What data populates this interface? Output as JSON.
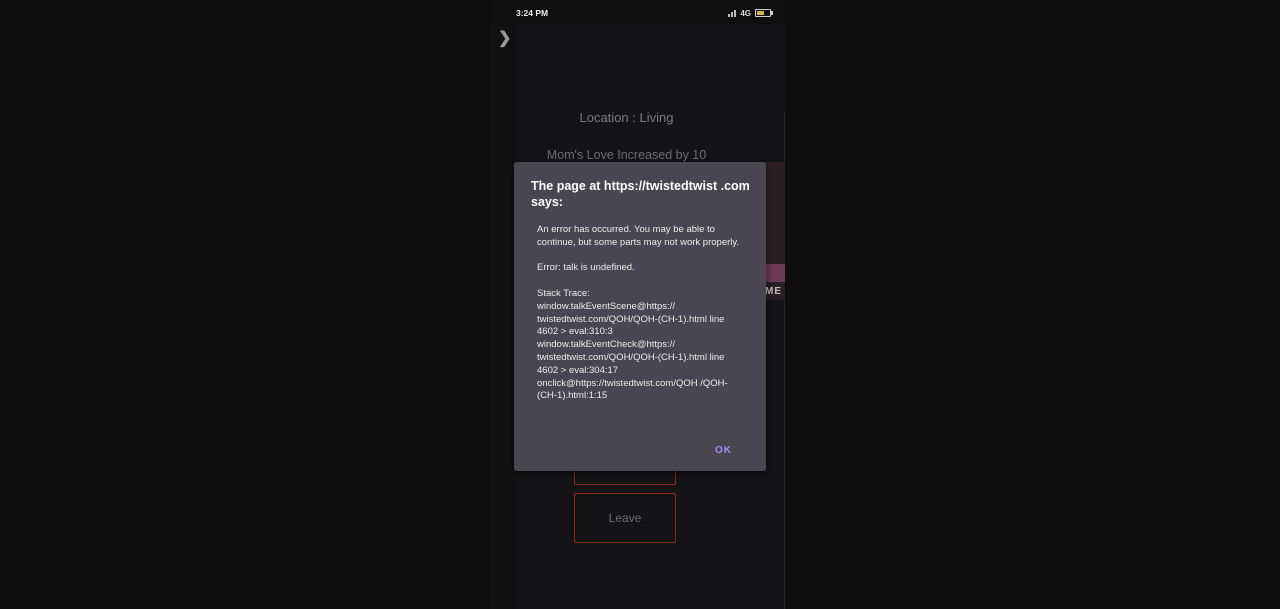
{
  "status_bar": {
    "time": "3:24 PM",
    "network": "4G"
  },
  "battery_level": 0.55,
  "game": {
    "location": "Location : Living",
    "notification": "Mom's Love Increased by 10",
    "scene_image_text": "ME",
    "leave_button": "Leave"
  },
  "dialog": {
    "title": "The page at https://twistedtwist .com says:",
    "message": "An error has occurred. You may be able to continue, but some parts may not work properly.\n\nError: talk is undefined.\n\nStack Trace:\nwindow.talkEventScene@https:// twistedtwist.com/QOH/QOH-(CH-1).html line 4602 > eval:310:3\nwindow.talkEventCheck@https:// twistedtwist.com/QOH/QOH-(CH-1).html line 4602 > eval:304:17\nonclick@https://twistedtwist.com/QOH /QOH-(CH-1).html:1:15",
    "ok_label": "OK"
  },
  "colors": {
    "accent": "#a98cf0",
    "dialog_bg": "#48464f",
    "button_border": "#8a2a1a"
  },
  "icons": {
    "sidebar_toggle": "chevron-right-icon",
    "signal": "signal-icon",
    "battery": "battery-icon"
  }
}
